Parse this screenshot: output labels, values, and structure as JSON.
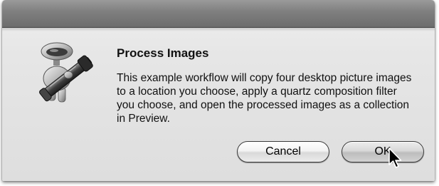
{
  "dialog": {
    "title": "Process Images",
    "message": "This example workflow will copy four desktop picture images to a location you choose, apply a quartz composition filter you choose, and open the processed images as a collection in Preview.",
    "icon": "automator-robot-icon"
  },
  "buttons": {
    "cancel_label": "Cancel",
    "ok_label": "OK"
  },
  "pointer": {
    "icon": "arrow-cursor-icon"
  },
  "colors": {
    "titlebar": "#7e7e7e",
    "dialog_background": "#e6e6e6",
    "button_border": "#3a3a3a",
    "text": "#111111"
  }
}
